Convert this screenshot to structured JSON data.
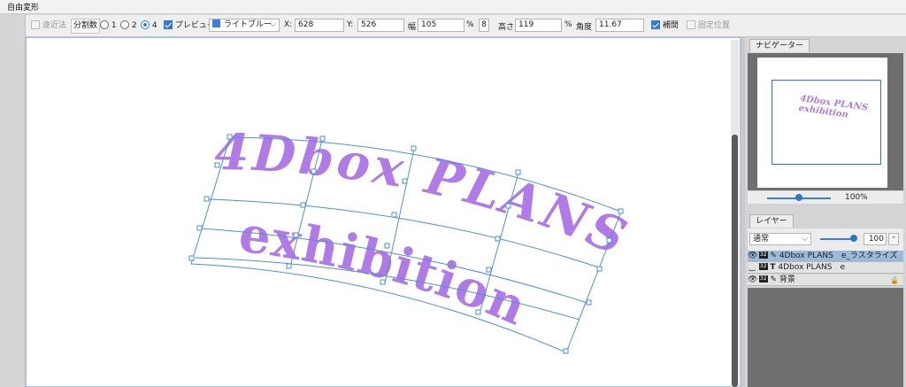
{
  "window": {
    "title": "自由変形"
  },
  "toolbar": {
    "perspective": {
      "label": "遠近法",
      "checked": false,
      "enabled": false
    },
    "divisions": {
      "label": "分割数",
      "options": [
        "1",
        "2",
        "4"
      ],
      "selected": "4"
    },
    "preview": {
      "label": "プレビュー",
      "checked": true
    },
    "color": {
      "value": "ライトブルー",
      "swatch": "#3b7ee6"
    },
    "x": {
      "label": "X:",
      "value": "628"
    },
    "y": {
      "label": "Y:",
      "value": "526"
    },
    "width": {
      "label": "幅",
      "value": "105",
      "unit": "%"
    },
    "height": {
      "label": "高さ",
      "value": "119",
      "unit": "%"
    },
    "angle": {
      "label": "角度",
      "value": "11.67"
    },
    "interpolate": {
      "label": "補間",
      "checked": true
    },
    "fixed_position": {
      "label": "固定位置",
      "checked": false,
      "enabled": false
    }
  },
  "canvas": {
    "line1": "4Dbox PLANS",
    "line2": "exhibition",
    "text_color": "#b07be8",
    "mesh_color": "#4f8fd6"
  },
  "navigator": {
    "tab": "ナビゲーター",
    "preview_line1": "4Dbox PLANS",
    "preview_line2": "exhibition",
    "zoom": "100%",
    "zoom_fraction": 0.5
  },
  "layers": {
    "tab": "レイヤー",
    "blend_mode": "通常",
    "opacity": "100",
    "opacity_fraction": 1.0,
    "items": [
      {
        "name": "4Dbox PLANS　e_ラスタライズ",
        "badge": "32",
        "selected": true
      },
      {
        "name": "4Dbox PLANS　e",
        "badge": "32",
        "selected": false
      },
      {
        "name": "背景",
        "badge": "32",
        "selected": false
      }
    ]
  }
}
